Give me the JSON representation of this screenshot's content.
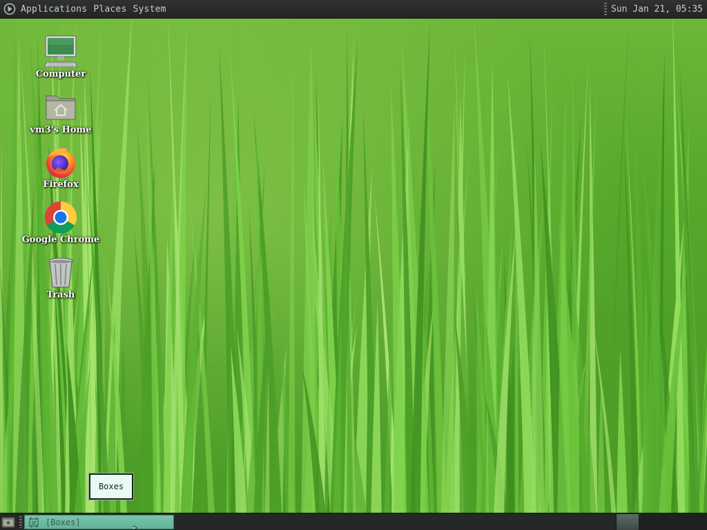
{
  "top_panel": {
    "menu": [
      "Applications",
      "Places",
      "System"
    ],
    "clock": "Sun Jan 21, 05:35"
  },
  "desktop_icons": [
    {
      "label": "Computer",
      "icon": "computer-icon"
    },
    {
      "label": "vm3's Home",
      "icon": "home-folder-icon"
    },
    {
      "label": "Firefox",
      "icon": "firefox-icon"
    },
    {
      "label": "Google Chrome",
      "icon": "chrome-icon"
    },
    {
      "label": "Trash",
      "icon": "trash-icon"
    }
  ],
  "tooltip": {
    "text": "Boxes"
  },
  "taskbar": {
    "tasks": [
      {
        "label": "[Boxes]",
        "icon": "boxes-app-icon"
      }
    ],
    "workspaces": 4,
    "active_workspace": 1
  },
  "colors": {
    "panel": "#262827",
    "task_active": "#6fbea3",
    "tooltip_bg": "#e8fbf3"
  }
}
